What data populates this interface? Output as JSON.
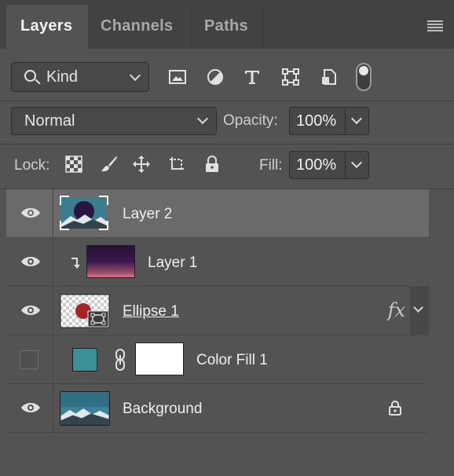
{
  "tabs": [
    {
      "label": "Layers",
      "active": true
    },
    {
      "label": "Channels",
      "active": false
    },
    {
      "label": "Paths",
      "active": false
    }
  ],
  "filter": {
    "kind_label": "Kind",
    "icons": [
      "image-filter-icon",
      "adjustment-filter-icon",
      "type-filter-icon",
      "shape-filter-icon",
      "smart-object-filter-icon",
      "filter-toggle"
    ]
  },
  "blend": {
    "mode": "Normal",
    "opacity_label": "Opacity:",
    "opacity_value": "100%"
  },
  "lock": {
    "label": "Lock:",
    "icons": [
      "lock-transparent-pixels-icon",
      "lock-image-pixels-icon",
      "lock-position-icon",
      "lock-artboard-icon",
      "lock-all-icon"
    ],
    "fill_label": "Fill:",
    "fill_value": "100%"
  },
  "layers": [
    {
      "name": "Layer 2",
      "visible": true,
      "selected": true
    },
    {
      "name": "Layer 1",
      "visible": true,
      "clipped": true
    },
    {
      "name": "Ellipse 1",
      "visible": true,
      "fx": "fx"
    },
    {
      "name": "Color Fill 1",
      "visible": false
    },
    {
      "name": "Background",
      "visible": true,
      "locked": true
    }
  ],
  "colors": {
    "panel": "#535353",
    "tabbar": "#424242",
    "selected_row": "#6a6a6a",
    "fill_swatch": "#3b8f96",
    "ellipse_red": "#a42424"
  }
}
